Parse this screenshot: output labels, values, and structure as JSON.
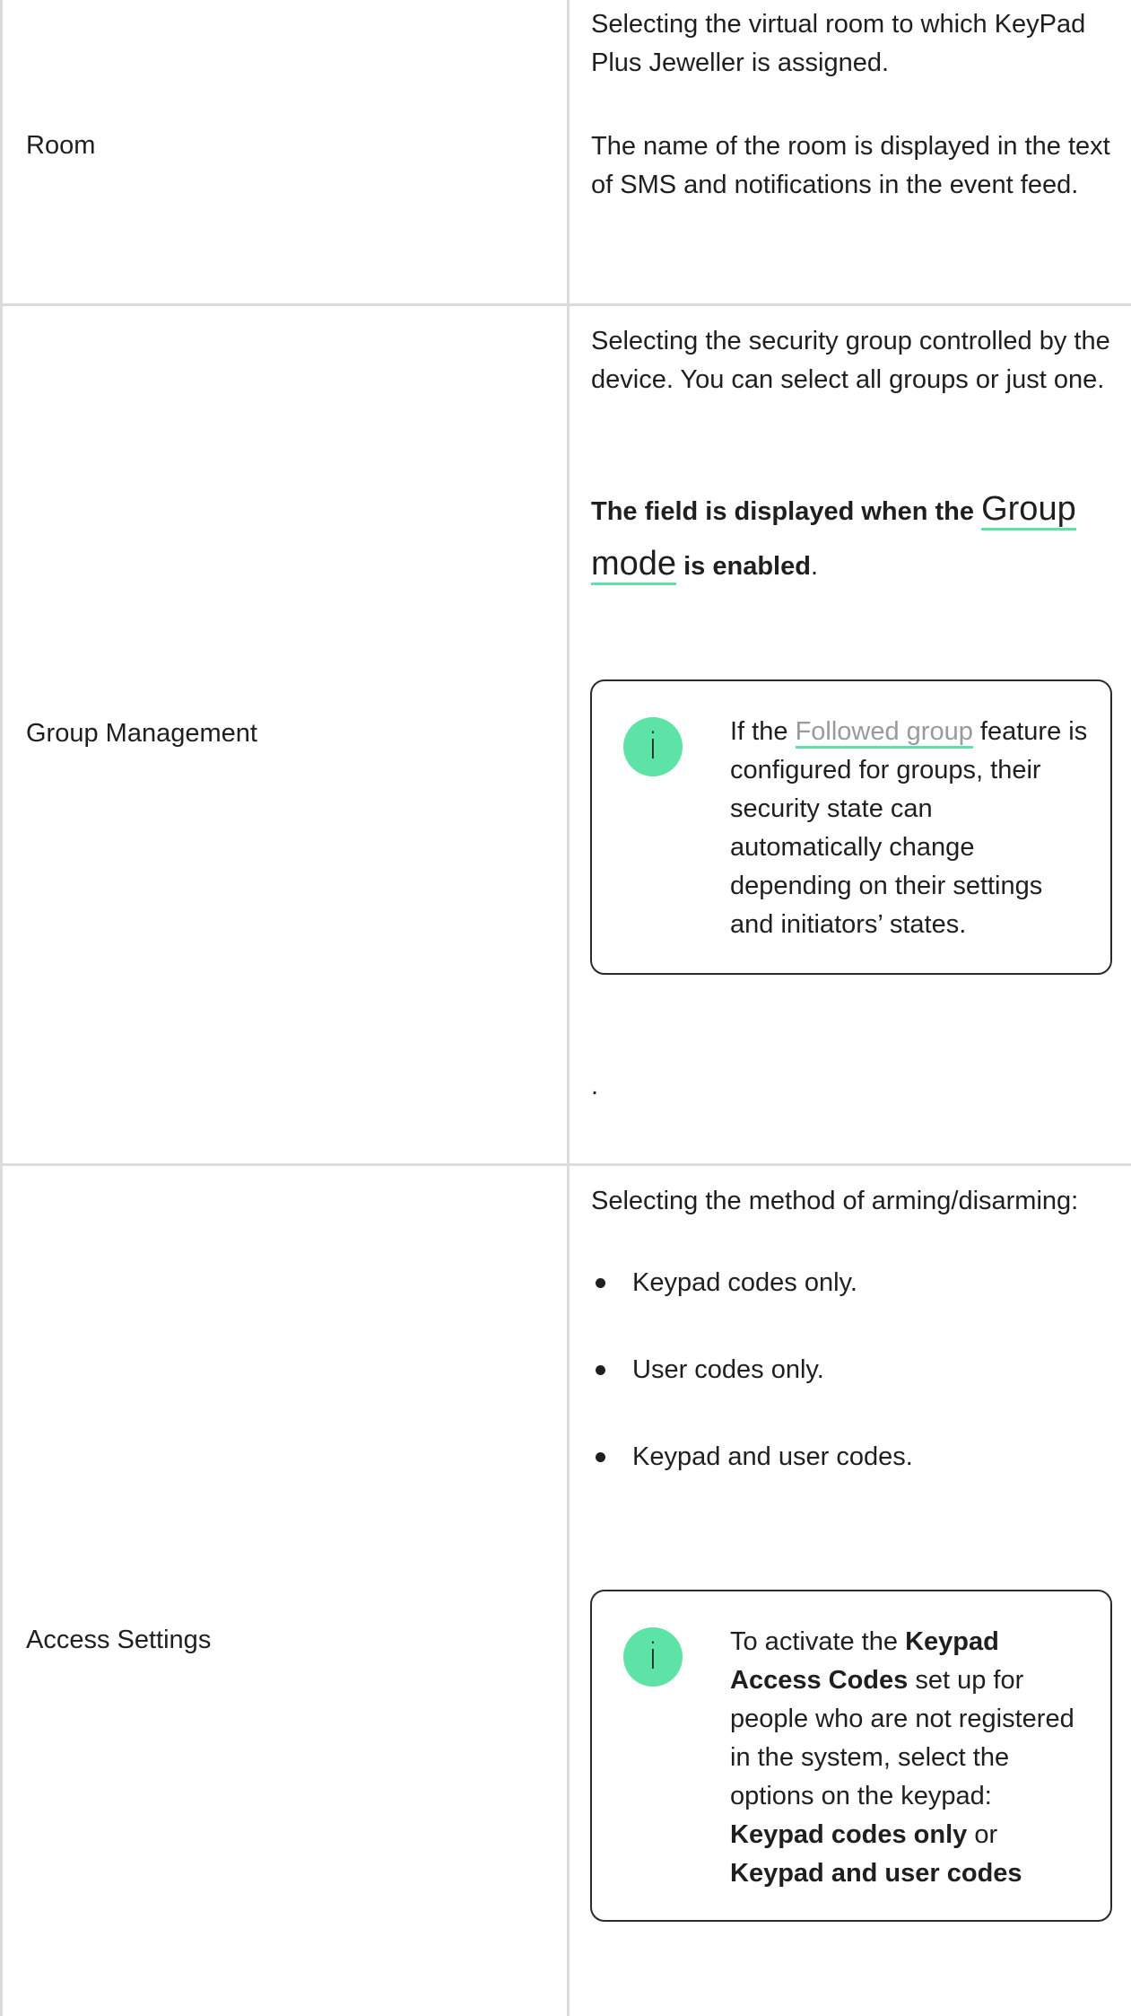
{
  "rows": [
    {
      "label": "Room",
      "paragraphs": [
        "Selecting the virtual room to which KeyPad Plus Jeweller is assigned.",
        "The name of the room is displayed in the text of SMS and notifications in the event feed."
      ]
    },
    {
      "label": "Group Management",
      "intro": "Selecting the security group controlled by the device. You can select all groups or just one.",
      "condition": {
        "prefix": "The field is displayed when the",
        "link": "Group mode",
        "suffix": "is enabled",
        "end": "."
      },
      "note": {
        "icon": "info-icon",
        "before": "If the",
        "link": "Followed group",
        "after": "feature is configured for groups, their security state can automatically change depending on their settings and initiators’ states."
      },
      "trailing": "."
    },
    {
      "label": "Access Settings",
      "intro": "Selecting the method of arming/disarming:",
      "options": [
        "Keypad codes only.",
        "User codes only.",
        "Keypad and user codes."
      ],
      "note": {
        "icon": "info-icon",
        "t1": "To activate the",
        "b1": "Keypad Access Codes",
        "t2": "set up for people who are not registered in the system, select the options on the keypad:",
        "b2": "Keypad codes only",
        "t3": "or",
        "b3": "Keypad and user codes"
      }
    }
  ],
  "colors": {
    "accent": "#5ee3a7",
    "border": "#dcdcdc",
    "text": "#1f1f1f",
    "link_gray": "#9a9a9a"
  }
}
